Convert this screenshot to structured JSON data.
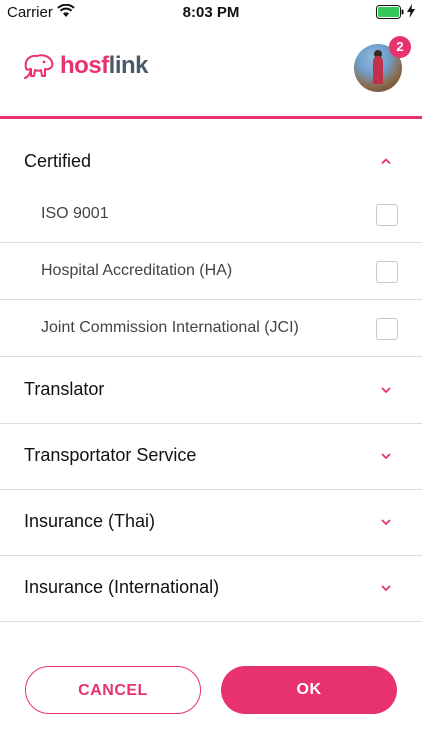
{
  "status_bar": {
    "carrier": "Carrier",
    "time": "8:03 PM"
  },
  "header": {
    "logo_text_part1": "hos",
    "logo_text_part2": "link",
    "notification_count": "2"
  },
  "sections": [
    {
      "title": "Certified",
      "expanded": true,
      "options": [
        {
          "label": "ISO 9001",
          "checked": false
        },
        {
          "label": "Hospital Accreditation (HA)",
          "checked": false
        },
        {
          "label": "Joint Commission International (JCI)",
          "checked": false
        }
      ]
    },
    {
      "title": "Translator",
      "expanded": false
    },
    {
      "title": "Transportator Service",
      "expanded": false
    },
    {
      "title": "Insurance (Thai)",
      "expanded": false
    },
    {
      "title": "Insurance (International)",
      "expanded": false
    }
  ],
  "actions": {
    "cancel_label": "CANCEL",
    "ok_label": "OK"
  },
  "colors": {
    "accent": "#e8326e",
    "logo_dark": "#4a5a6a"
  }
}
